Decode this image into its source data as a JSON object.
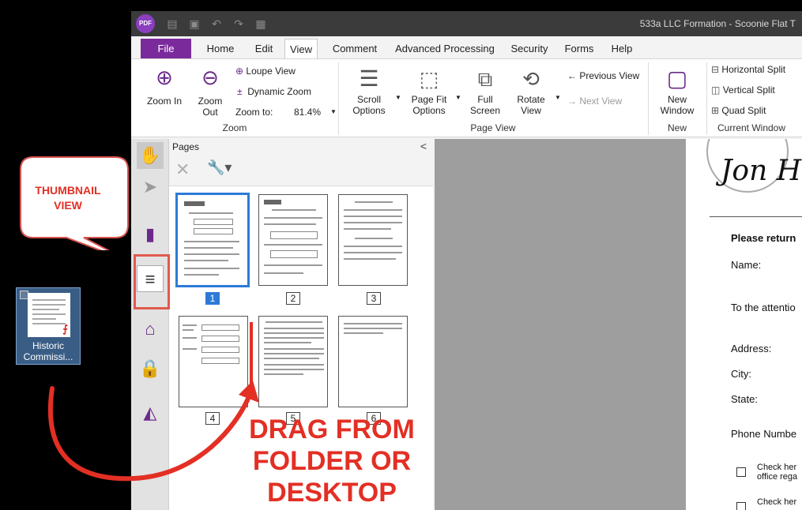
{
  "desktop": {
    "file_label_line1": "Historic",
    "file_label_line2": "Commissi..."
  },
  "window": {
    "title": "533a LLC Formation - Scoonie Flat T",
    "logo_text": "PDF"
  },
  "tabs": [
    {
      "label": "File"
    },
    {
      "label": "Home"
    },
    {
      "label": "Edit"
    },
    {
      "label": "View"
    },
    {
      "label": "Comment"
    },
    {
      "label": "Advanced Processing"
    },
    {
      "label": "Security"
    },
    {
      "label": "Forms"
    },
    {
      "label": "Help"
    }
  ],
  "ribbon": {
    "zoom_in": "Zoom In",
    "zoom_out_1": "Zoom",
    "zoom_out_2": "Out",
    "loupe": "Loupe View",
    "dynamic_zoom": "Dynamic Zoom",
    "zoom_to": "Zoom to:",
    "zoom_value": "81.4%",
    "zoom_group": "Zoom",
    "scroll_1": "Scroll",
    "scroll_2": "Options",
    "pagefit_1": "Page Fit",
    "pagefit_2": "Options",
    "full_1": "Full",
    "full_2": "Screen",
    "rotate_1": "Rotate",
    "rotate_2": "View",
    "prev_view": "Previous View",
    "next_view": "Next View",
    "pageview_group": "Page View",
    "new_1": "New",
    "new_2": "Window",
    "new_group": "New",
    "hsplit": "Horizontal Split",
    "vsplit": "Vertical Split",
    "qsplit": "Quad Split",
    "current_group": "Current Window"
  },
  "panel": {
    "title": "Pages",
    "close": "<",
    "pages": [
      "1",
      "2",
      "3",
      "4",
      "5",
      "6"
    ]
  },
  "document": {
    "please": "Please return",
    "name": "Name:",
    "attention": "To the attentio",
    "address": "Address:",
    "city": "City:",
    "state": "State:",
    "phone": "Phone Numbe",
    "check1a": "Check her",
    "check1b": "office rega",
    "check2a": "Check her"
  },
  "annotations": {
    "callout_line1": "THUMBNAIL",
    "callout_line2": "VIEW",
    "drag_line1": "DRAG FROM",
    "drag_line2": "FOLDER OR",
    "drag_line3": "DESKTOP",
    "accent_color": "#e32f24"
  }
}
